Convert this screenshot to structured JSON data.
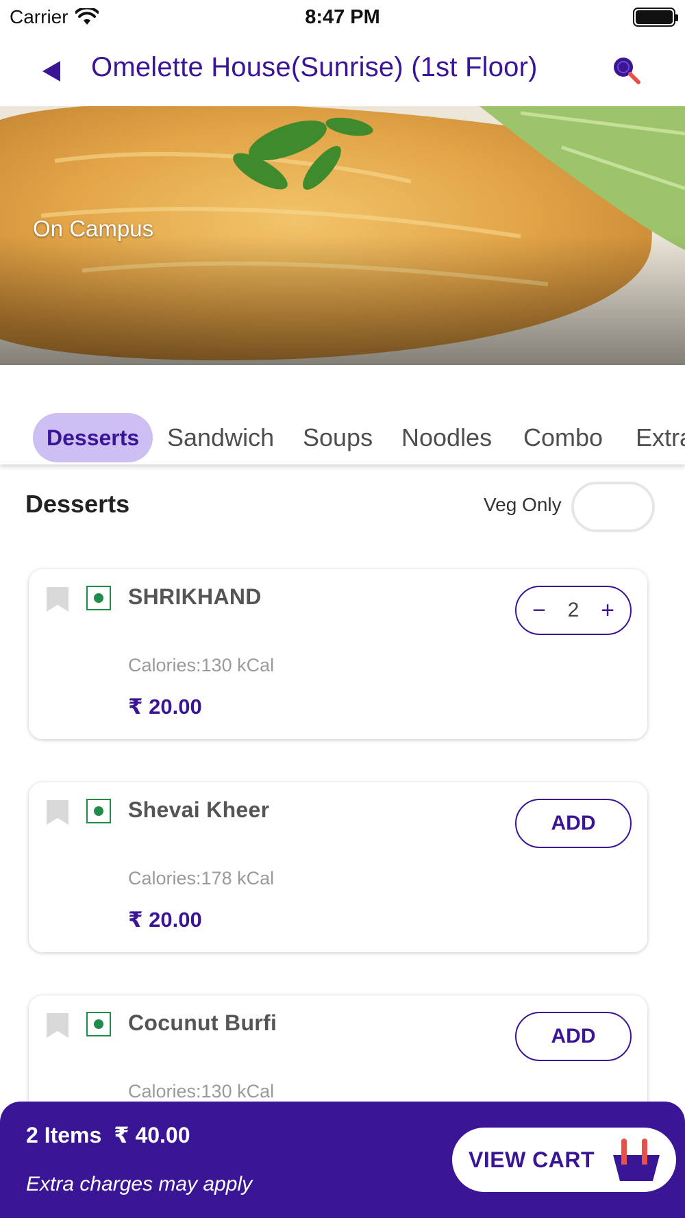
{
  "status_bar": {
    "carrier": "Carrier",
    "time": "8:47 PM"
  },
  "nav": {
    "title": "Omelette House(Sunrise) (1st Floor)",
    "back_icon": "back-arrow-icon",
    "search_icon": "search-icon"
  },
  "hero": {
    "label": "On Campus"
  },
  "tabs": [
    {
      "label": "Desserts",
      "active": true
    },
    {
      "label": "Sandwich",
      "active": false
    },
    {
      "label": "Soups",
      "active": false
    },
    {
      "label": "Noodles",
      "active": false
    },
    {
      "label": "Combo",
      "active": false
    },
    {
      "label": "Extra",
      "active": false
    }
  ],
  "section": {
    "title": "Desserts",
    "veg_only_label": "Veg Only",
    "veg_only_enabled": false
  },
  "items": [
    {
      "name": "SHRIKHAND",
      "calories": "Calories:130 kCal",
      "price": "₹ 20.00",
      "quantity": "2",
      "action": "stepper"
    },
    {
      "name": "Shevai Kheer",
      "calories": "Calories:178 kCal",
      "price": "₹ 20.00",
      "add_label": "ADD",
      "action": "add"
    },
    {
      "name": "Cocunut Burfi",
      "calories": "Calories:130 kCal",
      "price": "",
      "add_label": "ADD",
      "action": "add"
    }
  ],
  "stepper": {
    "minus": "−",
    "plus": "+"
  },
  "cart": {
    "count": "2 Items",
    "total": "₹ 40.00",
    "note": "Extra charges may apply",
    "button_label": "VIEW CART"
  },
  "colors": {
    "brand": "#3a1596",
    "tab_active_bg": "#cdbef3",
    "veg_green": "#1f8c4a",
    "accent_red": "#e8514a"
  }
}
